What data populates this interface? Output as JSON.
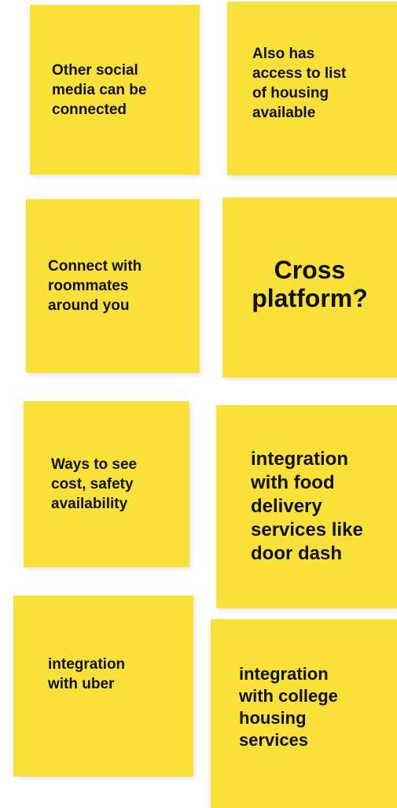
{
  "board": {
    "note_color": "#f9e13a",
    "notes": [
      {
        "text": "Other social\nmedia can be\nconnected"
      },
      {
        "text": "Also has\naccess to list\nof housing\navailable"
      },
      {
        "text": "Connect with\nroommates\naround you"
      },
      {
        "text": "Cross\nplatform?"
      },
      {
        "text": "Ways to see\ncost, safety\navailability"
      },
      {
        "text": "integration\nwith food\ndelivery\nservices like\ndoor dash"
      },
      {
        "text": "integration\nwith uber"
      },
      {
        "text": "integration\nwith college\nhousing\nservices"
      }
    ]
  }
}
